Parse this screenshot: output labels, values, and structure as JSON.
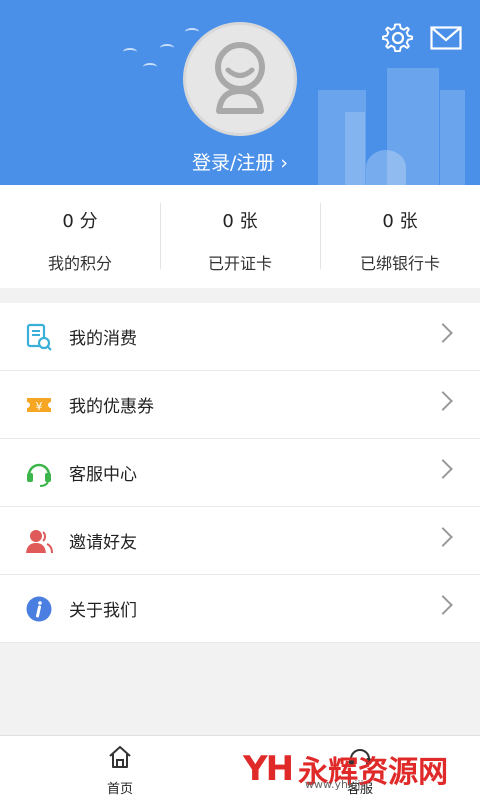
{
  "header": {
    "login_label": "登录/注册 ›"
  },
  "stats": [
    {
      "value": "0 分",
      "label": "我的积分"
    },
    {
      "value": "0 张",
      "label": "已开证卡"
    },
    {
      "value": "0 张",
      "label": "已绑银行卡"
    }
  ],
  "menu": [
    {
      "label": "我的消费",
      "icon": "receipt-icon",
      "color": "#3ab0d8"
    },
    {
      "label": "我的优惠券",
      "icon": "coupon-icon",
      "color": "#f5a623"
    },
    {
      "label": "客服中心",
      "icon": "headset-icon",
      "color": "#3cb54a"
    },
    {
      "label": "邀请好友",
      "icon": "invite-user-icon",
      "color": "#e05a5a"
    },
    {
      "label": "关于我们",
      "icon": "info-icon",
      "color": "#4a7ee0"
    }
  ],
  "tabbar": [
    {
      "label": "首页",
      "icon": "home-icon"
    },
    {
      "label": "客服",
      "icon": "service-icon"
    }
  ],
  "watermark": {
    "logo": "YH",
    "name": "永辉资源网",
    "url": "www.yhkjjj"
  },
  "colors": {
    "brand": "#4a90e8"
  }
}
